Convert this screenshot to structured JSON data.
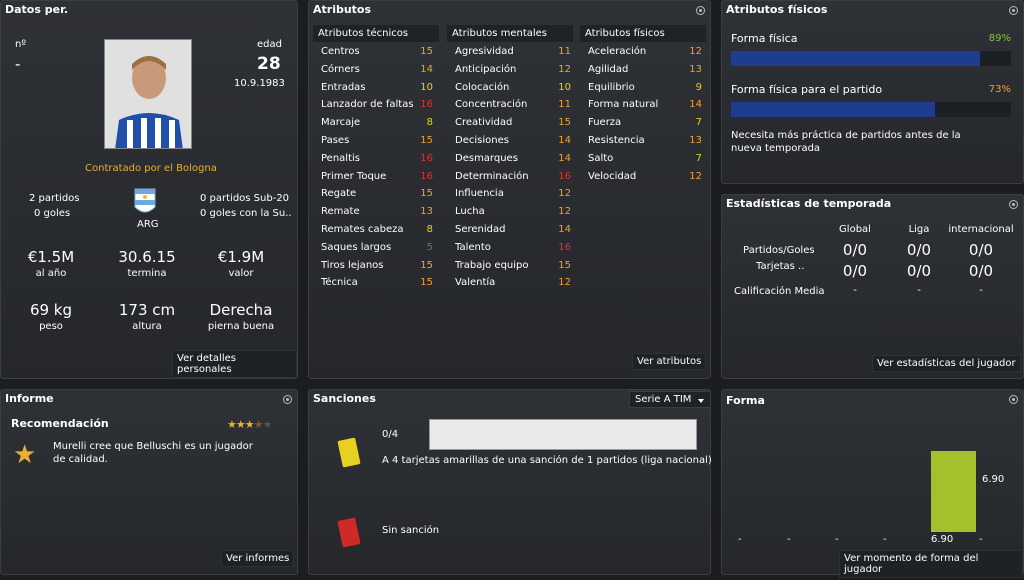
{
  "personal": {
    "title": "Datos per.",
    "num_label": "nº",
    "num_value": "-",
    "age_label": "edad",
    "age": "28",
    "dob": "10.9.1983",
    "contract": "Contratado por el Bologna",
    "nation": "ARG",
    "left_stats": [
      "2 partidos",
      "0 goles"
    ],
    "right_stats": [
      "0 partidos Sub-20",
      "0 goles con la Su.."
    ],
    "wage": "€1.5M",
    "wage_label": "al año",
    "expires": "30.6.15",
    "expires_label": "termina",
    "value": "€1.9M",
    "value_label": "valor",
    "weight": "69 kg",
    "weight_label": "peso",
    "height": "173 cm",
    "height_label": "altura",
    "foot": "Derecha",
    "foot_label": "pierna buena",
    "link": "Ver detalles personales"
  },
  "attributes": {
    "title": "Atributos",
    "link": "Ver atributos",
    "technical": {
      "header": "Atributos técnicos",
      "rows": [
        [
          "Centros",
          "15"
        ],
        [
          "Córners",
          "14"
        ],
        [
          "Entradas",
          "10"
        ],
        [
          "Lanzador de faltas",
          "16"
        ],
        [
          "Marcaje",
          "8"
        ],
        [
          "Pases",
          "15"
        ],
        [
          "Penaltis",
          "16"
        ],
        [
          "Primer Toque",
          "16"
        ],
        [
          "Regate",
          "15"
        ],
        [
          "Remate",
          "13"
        ],
        [
          "Remates cabeza",
          "8"
        ],
        [
          "Saques largos",
          "5"
        ],
        [
          "Tiros lejanos",
          "15"
        ],
        [
          "Técnica",
          "15"
        ]
      ]
    },
    "mental": {
      "header": "Atributos mentales",
      "rows": [
        [
          "Agresividad",
          "11"
        ],
        [
          "Anticipación",
          "12"
        ],
        [
          "Colocación",
          "10"
        ],
        [
          "Concentración",
          "11"
        ],
        [
          "Creatividad",
          "15"
        ],
        [
          "Decisiones",
          "14"
        ],
        [
          "Desmarques",
          "14"
        ],
        [
          "Determinación",
          "16"
        ],
        [
          "Influencia",
          "12"
        ],
        [
          "Lucha",
          "12"
        ],
        [
          "Serenidad",
          "14"
        ],
        [
          "Talento",
          "16"
        ],
        [
          "Trabajo equipo",
          "15"
        ],
        [
          "Valentía",
          "12"
        ]
      ]
    },
    "physical": {
      "header": "Atributos físicos",
      "rows": [
        [
          "Aceleración",
          "12"
        ],
        [
          "Agilidad",
          "13"
        ],
        [
          "Equilibrio",
          "9"
        ],
        [
          "Forma natural",
          "14"
        ],
        [
          "Fuerza",
          "7"
        ],
        [
          "Resistencia",
          "13"
        ],
        [
          "Salto",
          "7"
        ],
        [
          "Velocidad",
          "12"
        ]
      ]
    }
  },
  "fitness": {
    "title": "Atributos físicos",
    "condition_label": "Forma física",
    "condition_pct": "89%",
    "condition_value": 0.89,
    "match_label": "Forma física para el partido",
    "match_pct": "73%",
    "match_value": 0.73,
    "note": "Necesita más práctica de partidos antes de la nueva temporada"
  },
  "season": {
    "title": "Estadísticas de temporada",
    "headers": [
      "Global",
      "Liga",
      "internacional"
    ],
    "row1_label": "Partidos/Goles",
    "row2_label": "Tarjetas ..",
    "row1": [
      "0/0",
      "0/0",
      "0/0"
    ],
    "row2": [
      "0/0",
      "0/0",
      "0/0"
    ],
    "rating_label": "Calificación Media",
    "rating": [
      "-",
      "-",
      "-"
    ],
    "link": "Ver estadísticas del jugador"
  },
  "report": {
    "title": "Informe",
    "rec_label": "Recomendación",
    "text": "Murelli cree que Belluschi es un jugador de calidad.",
    "link": "Ver informes",
    "stars": 3.5
  },
  "sanctions": {
    "title": "Sanciones",
    "dropdown": "Serie A TIM",
    "yellow_count": "0/4",
    "yellow_text": "A 4 tarjetas amarillas de una sanción de 1 partidos (liga nacional)",
    "red_text": "Sin sanción"
  },
  "form": {
    "title": "Forma",
    "value_label": "6.90",
    "bottom_label": "6.90",
    "dashes": [
      "-",
      "-",
      "-",
      "-",
      "-"
    ],
    "link": "Ver momento de forma del jugador",
    "value": 6.9,
    "max": 10
  },
  "colors": {
    "orange": "#f0a030",
    "yellow": "#e8d020",
    "red": "#e03030",
    "green": "#8ac040",
    "bar": "#1f3d8f",
    "form_bar": "#a4c02a",
    "gold": "#e8b030"
  }
}
